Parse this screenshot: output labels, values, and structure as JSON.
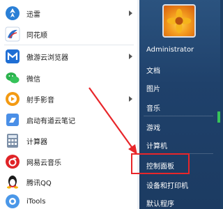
{
  "programs": [
    {
      "label": "迅雷",
      "icon": "xunlei-icon",
      "has_submenu": true
    },
    {
      "label": "同花顺",
      "icon": "tonghuashun-icon",
      "has_submenu": false
    },
    {
      "label": "傲游云浏览器",
      "icon": "maxthon-icon",
      "has_submenu": true
    },
    {
      "label": "微信",
      "icon": "wechat-icon",
      "has_submenu": false
    },
    {
      "label": "射手影音",
      "icon": "shooter-player-icon",
      "has_submenu": true
    },
    {
      "label": "启动有道云笔记",
      "icon": "youdao-note-icon",
      "has_submenu": false
    },
    {
      "label": "计算器",
      "icon": "calculator-icon",
      "has_submenu": false
    },
    {
      "label": "网易云音乐",
      "icon": "netease-music-icon",
      "has_submenu": false
    },
    {
      "label": "腾讯QQ",
      "icon": "qq-icon",
      "has_submenu": false
    },
    {
      "label": "iTools",
      "icon": "itools-icon",
      "has_submenu": false
    }
  ],
  "right_menu": {
    "user": "Administrator",
    "items": [
      "文档",
      "图片",
      "音乐",
      "游戏",
      "计算机",
      "控制面板",
      "设备和打印机",
      "默认程序"
    ],
    "highlighted": "控制面板"
  },
  "colors": {
    "highlight": "#e8262a",
    "panel": "#1f416b"
  }
}
